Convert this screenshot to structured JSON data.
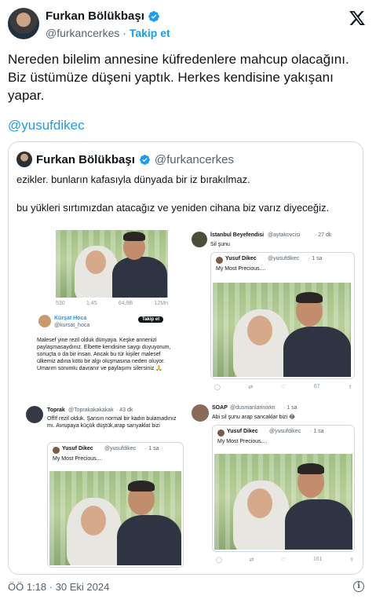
{
  "author": {
    "name": "Furkan Bölükbaşı",
    "handle": "@furkancerkes",
    "separator": "·",
    "follow": "Takip et"
  },
  "tweet": {
    "text": "Nereden bilelim annesine küfredenlere mahcup olacağını. Biz üstümüze düşeni yaptık. Herkes kendisine yakışanı yapar.",
    "mention": "@yusufdikec"
  },
  "quote": {
    "name": "Furkan Bölükbaşı",
    "handle": "@furkancerkes",
    "line1": "ezikler. bunların kafasıyla dünyada bir iz bırakılmaz.",
    "line2": "bu yükleri sırtımızdan atacağız ve yeniden cihana biz varız diyeceğiz."
  },
  "collage": {
    "p1_actions": [
      "530",
      "1,45",
      "64,9B",
      "12Mn"
    ],
    "kursat": {
      "name": "Kürşat Hoca",
      "handle": "@kursat_hoca",
      "follow": "Takip et",
      "text": "Malesef yine rezil olduk dünyaya. Keşke annenizi paylaşmasaydınız. Elbette kendisine saygı duyuyorum, sonuçta o da bir insan. Ancak bu tür kişiler malesef ülkemiz adına kötü bir algı oluşmasına neden oluyor. Umarım sorumlu davranır ve paylaşımı silersiniz 🙏"
    },
    "istanbul": {
      "name": "İstanbul Beyefendisi",
      "handle": "@aytakovcisi",
      "time": "· 27 dk",
      "text": "Sil şunu",
      "inner_name": "Yusuf Dikec",
      "inner_handle": "@yusufdikec",
      "inner_time": "· 1 sa",
      "inner_text": "My Most Precious....",
      "views": "67"
    },
    "toprak": {
      "name": "Toprak",
      "handle": "@Toprakakakakak",
      "time": "· 43 dk",
      "text": "Off!f rezil olduk. Şansın normal bir kadın bulamadınız mı. Avrupaya küçük düştük,arap sarıyaklat bizi",
      "inner_name": "Yusuf Dikec",
      "inner_handle": "@yusufdikec",
      "inner_time": "· 1 sa",
      "inner_text": "My Most Precious...."
    },
    "soap": {
      "name": "SOAP",
      "handle": "@dusmanlarinixkn",
      "time": "· 1 sa",
      "text": "Abi sil şunu arap sancaklar bizi 😂",
      "inner_name": "Yusuf Dikec",
      "inner_handle": "@yusufdikec",
      "inner_time": "· 1 sa",
      "inner_text": "My Most Precious....",
      "views": "161"
    }
  },
  "footer": {
    "time": "ÖÖ 1:18 · 30 Eki 2024",
    "info": "i"
  },
  "colors": {
    "link": "#1d9bf0",
    "secondary": "#536471",
    "border": "#cfd9de"
  }
}
